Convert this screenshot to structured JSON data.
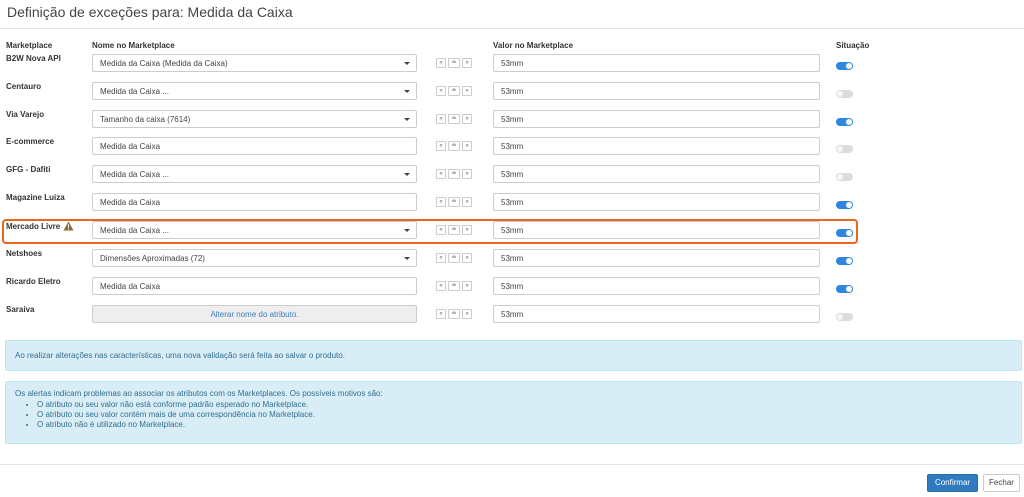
{
  "dialog": {
    "title": "Definição de exceções para: Medida da Caixa"
  },
  "columns": {
    "marketplace": "Marketplace",
    "name": "Nome no Marketplace",
    "value": "Valor no Marketplace",
    "status": "Situação"
  },
  "rows": [
    {
      "marketplace": "B2W Nova API",
      "name": "Medida da Caixa (Medida da Caixa)",
      "name_type": "select",
      "value": "53mm",
      "active": true
    },
    {
      "marketplace": "Centauro",
      "name": "Medida da Caixa ...",
      "name_type": "select",
      "value": "53mm",
      "active": false
    },
    {
      "marketplace": "Via Varejo",
      "name": "Tamanho da caixa (7614)",
      "name_type": "select",
      "value": "53mm",
      "active": true
    },
    {
      "marketplace": "E-commerce",
      "name": "Medida da Caixa",
      "name_type": "text",
      "value": "53mm",
      "active": false
    },
    {
      "marketplace": "GFG - Dafiti",
      "name": "Medida da Caixa ...",
      "name_type": "select",
      "value": "53mm",
      "active": false
    },
    {
      "marketplace": "Magazine Luiza",
      "name": "Medida da Caixa",
      "name_type": "text",
      "value": "53mm",
      "active": true
    },
    {
      "marketplace": "Mercado Livre",
      "name": "Medida da Caixa ...",
      "name_type": "select",
      "value": "53mm",
      "active": true,
      "warning": true
    },
    {
      "marketplace": "Netshoes",
      "name": "Dimensões Aproximadas (72)",
      "name_type": "select",
      "value": "53mm",
      "active": true
    },
    {
      "marketplace": "Ricardo Eletro",
      "name": "Medida da Caixa",
      "name_type": "text",
      "value": "53mm",
      "active": true
    },
    {
      "marketplace": "Saraiva",
      "name": "Alterar nome do atributo.",
      "name_type": "readonly",
      "value": "53mm",
      "active": false
    }
  ],
  "copy_buttons": {
    "left": "«",
    "middle": "≐",
    "right": "»"
  },
  "icons": {
    "warning": "warning-icon",
    "caret": "chevron-down-icon"
  },
  "colors": {
    "accent": "#2e87e0",
    "highlight": "#e8661d",
    "info_bg": "#d9edf7",
    "info_text": "#31708f"
  },
  "notices": {
    "validation": "Ao realizar alterações nas características, uma nova validação será feita ao salvar o produto.",
    "alerts_intro": "Os alertas indicam problemas ao associar os atributos com os Marketplaces. Os possíveis motivos são:",
    "alerts_reasons": [
      "O atributo ou seu valor não está conforme padrão esperado no Marketplace.",
      "O atributo ou seu valor contém mais de uma correspondência no Marketplace.",
      "O atributo não é utilizado no Marketplace."
    ]
  },
  "footer": {
    "confirm": "Confirmar",
    "close": "Fechar"
  }
}
